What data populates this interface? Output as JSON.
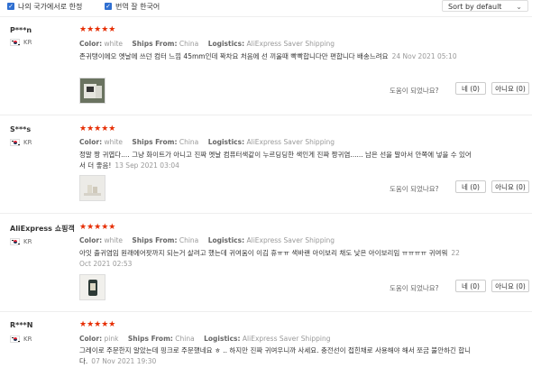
{
  "filters": {
    "my_country_label": "나의 국가에서로 한정",
    "translate_label": "번역 잘 한국어",
    "sort_label": "Sort by default"
  },
  "labels": {
    "color": "Color:",
    "ships_from": "Ships From:",
    "logistics": "Logistics:",
    "helpful": "도움이 되었나요?",
    "yes": "네 (0)",
    "no": "아니요 (0)"
  },
  "reviews": [
    {
      "user": "P***n",
      "country": "KR",
      "stars": "★★★★★",
      "color": "white",
      "ships_from": "China",
      "logistics": "AliExpress Saver Shipping",
      "text": "존귀탱이에오 옛날에 쓰던 컴터 느낌 45mm인데 꽉차요 처음에 선 끼울때 빡빡합니다만 편합니다 배송느려요",
      "date": "24 Nov 2021 05:10"
    },
    {
      "user": "S***s",
      "country": "KR",
      "stars": "★★★★★",
      "color": "white",
      "ships_from": "China",
      "logistics": "AliExpress Saver Shipping",
      "text": "정말 짱 귀엽다.... 그냥 화이트가 아니고 진짜 옛날 컴퓨터색같이 누르딩딩한 색인게 진짜 짱귀염...... 남은 선을 말아서 안쪽에 넣을 수 있어서 더 좋음!",
      "date": "13 Sep 2021 03:04"
    },
    {
      "user": "AliExpress 쇼핑객",
      "country": "KR",
      "stars": "★★★★★",
      "color": "white",
      "ships_from": "China",
      "logistics": "AliExpress Saver Shipping",
      "text": "아잇 출귀염임 원래에어팟까지 되는거 살려고 했는데 귀여움이 이김 휴ㅠㅠ 색바랜 아이보리 채도 낮은 아이보리임 ㅠㅠㅠㅠ 귀여워",
      "date": "22 Oct 2021 02:53"
    },
    {
      "user": "R***N",
      "country": "KR",
      "stars": "★★★★★",
      "color": "pink",
      "ships_from": "China",
      "logistics": "AliExpress Saver Shipping",
      "text": "그레이로 주문한지 알았는데 핑크로 주문했네요 ㅎ .. 하지만 진짜 귀여우니까 사세요. 충전선이 접힌채로 사용해야 해서 쪼금 불안하긴 합니다.",
      "date": "07 Nov 2021 19:30"
    }
  ]
}
